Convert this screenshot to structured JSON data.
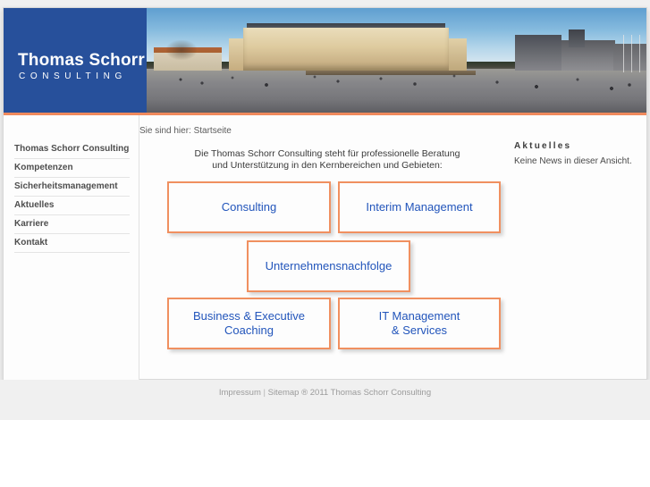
{
  "site": {
    "logo_name": "Thomas Schorr",
    "logo_sub": "CONSULTING",
    "accent_blue": "#27509b",
    "accent_orange": "#f08a5d",
    "link_blue": "#2255bb"
  },
  "header": {
    "hero_image_alt": "Neues Schloss Stuttgart panorama"
  },
  "breadcrumb": {
    "text": "Sie sind hier: Startseite"
  },
  "sidebar": {
    "items": [
      {
        "label": "Thomas Schorr Consulting"
      },
      {
        "label": "Kompetenzen"
      },
      {
        "label": "Sicherheitsmanagement"
      },
      {
        "label": "Aktuelles"
      },
      {
        "label": "Karriere"
      },
      {
        "label": "Kontakt"
      }
    ]
  },
  "main": {
    "intro_line1": "Die Thomas Schorr Consulting steht für professionelle Beratung",
    "intro_line2": "und Unterstützung in den Kernbereichen und Gebieten:",
    "boxes": [
      {
        "label": "Consulting"
      },
      {
        "label": "Interim Management"
      },
      {
        "label": "Unternehmensnachfolge"
      },
      {
        "label_line1": "Business & Executive",
        "label_line2": "Coaching"
      },
      {
        "label_line1": "IT Management",
        "label_line2": "& Services"
      }
    ]
  },
  "news": {
    "title": "Aktuelles",
    "text": "Keine News in dieser Ansicht."
  },
  "footer": {
    "impressum": "Impressum",
    "separator": " | ",
    "sitemap": "Sitemap",
    "copyright": " ® 2011 Thomas Schorr Consulting"
  }
}
